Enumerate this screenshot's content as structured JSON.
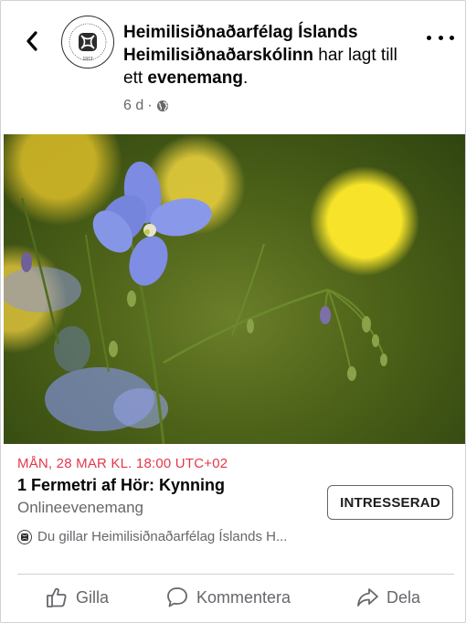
{
  "header": {
    "page_name": "Heimilisiðnaðarfélag Íslands",
    "co_host": "Heimilisiðnaðarskólinn",
    "action_text": " har lagt till ett ",
    "event_word": "evenemang",
    "period": ".",
    "timestamp": "6 d",
    "separator": "·",
    "privacy_icon": "globe-icon",
    "avatar_year": "1913"
  },
  "event": {
    "date": "MÅN, 28 MAR KL. 18:00 UTC+02",
    "title": "1 Fermetri af Hör: Kynning",
    "type": "Onlineevenemang",
    "interest_button": "INTRESSERAD",
    "likes_text": "Du gillar Heimilisiðnaðarfélag Íslands H..."
  },
  "actions": {
    "like": "Gilla",
    "comment": "Kommentera",
    "share": "Dela"
  },
  "colors": {
    "date_accent": "#e4374b",
    "secondary_text": "#65676b"
  }
}
